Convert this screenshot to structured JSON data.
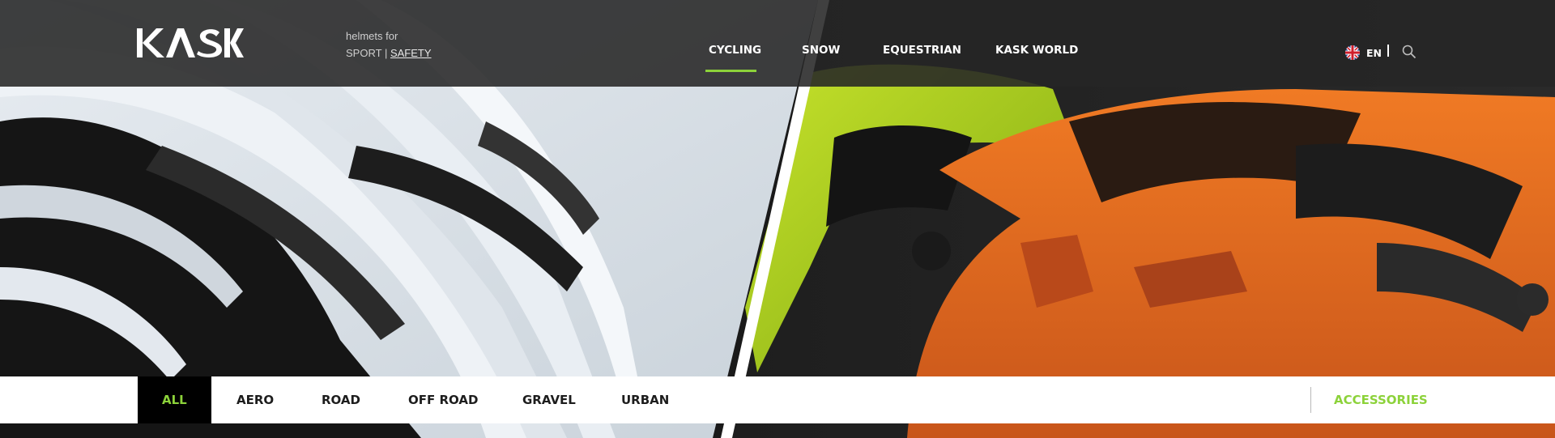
{
  "brand": {
    "logo_text": "KASK"
  },
  "tagline": {
    "line1": "helmets for",
    "sport": "SPORT",
    "divider": "|",
    "safety": "SAFETY"
  },
  "nav": {
    "items": [
      {
        "label": "CYCLING",
        "active": true
      },
      {
        "label": "SNOW"
      },
      {
        "label": "EQUESTRIAN"
      },
      {
        "label": "KASK WORLD"
      }
    ],
    "accent_color": "#8cd23a"
  },
  "language": {
    "code": "EN",
    "flag_icon": "uk-flag-icon"
  },
  "search": {
    "icon": "search-icon"
  },
  "subnav": {
    "items": [
      {
        "label": "ALL",
        "active": true
      },
      {
        "label": "AERO"
      },
      {
        "label": "ROAD"
      },
      {
        "label": "OFF ROAD"
      },
      {
        "label": "GRAVEL"
      },
      {
        "label": "URBAN"
      }
    ],
    "accessories": "ACCESSORIES",
    "accent_color": "#8cd23a"
  },
  "hero": {
    "left_helmet_color": "#dfe6ee",
    "right_helmet_colors": [
      "#a8d610",
      "#e0651c"
    ]
  }
}
